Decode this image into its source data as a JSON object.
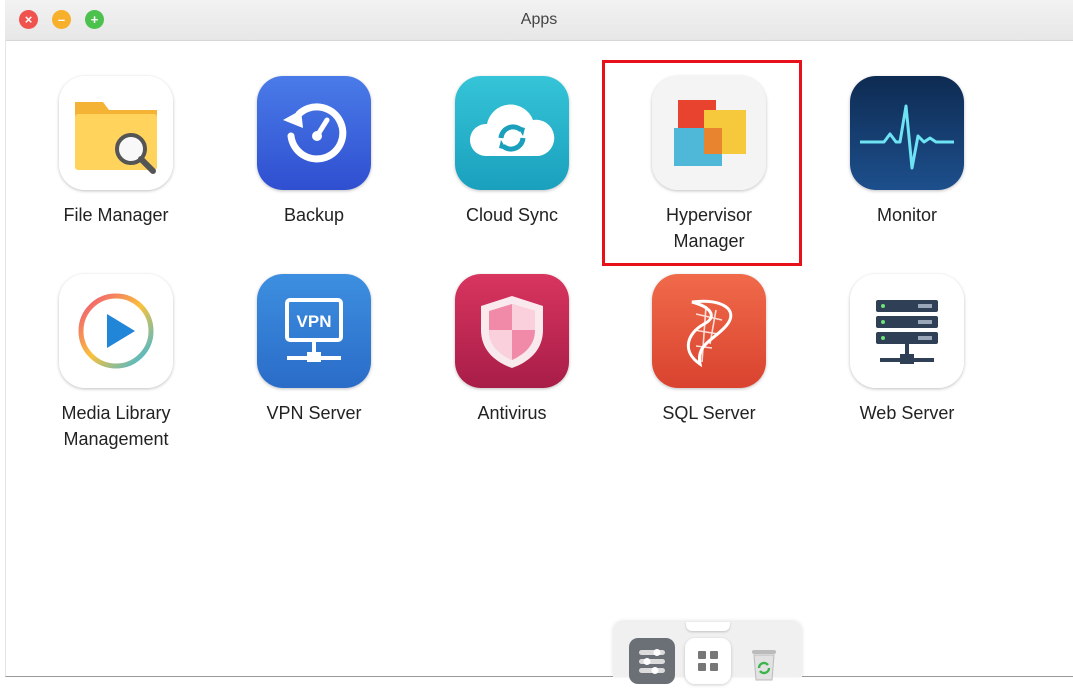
{
  "window": {
    "title": "Apps",
    "controls": [
      "close",
      "minimize",
      "maximize"
    ]
  },
  "apps": [
    {
      "label": "File Manager",
      "icon": "folder-search-icon"
    },
    {
      "label": "Backup",
      "icon": "backup-clock-icon"
    },
    {
      "label": "Cloud Sync",
      "icon": "cloud-sync-icon"
    },
    {
      "label": "Hypervisor\nManager",
      "icon": "hypervisor-windows-icon",
      "highlighted": true
    },
    {
      "label": "Monitor",
      "icon": "heartbeat-monitor-icon"
    },
    {
      "label": "Media Library\nManagement",
      "icon": "media-play-icon"
    },
    {
      "label": "VPN Server",
      "icon": "vpn-icon"
    },
    {
      "label": "Antivirus",
      "icon": "shield-icon"
    },
    {
      "label": "SQL Server",
      "icon": "sql-server-icon"
    },
    {
      "label": "Web Server",
      "icon": "web-server-icon"
    }
  ],
  "dock": {
    "items": [
      "control-panel-icon",
      "apps-grid-icon",
      "recycle-bin-icon"
    ]
  },
  "colors": {
    "highlight": "#e8101a",
    "titlebar": "#ececec"
  }
}
